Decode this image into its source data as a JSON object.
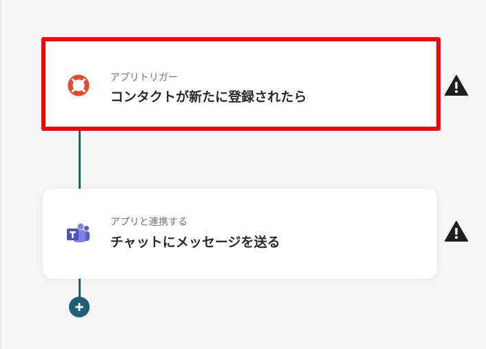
{
  "flow": {
    "steps": [
      {
        "type_label": "アプリトリガー",
        "title": "コンタクトが新たに登録されたら",
        "icon": "lifebuoy-icon",
        "highlighted": true
      },
      {
        "type_label": "アプリと連携する",
        "title": "チャットにメッセージを送る",
        "icon": "teams-icon",
        "highlighted": false
      }
    ],
    "warning_icon": "warning-icon",
    "add_icon": "plus-icon"
  },
  "colors": {
    "highlight_border": "#ff0000",
    "connector": "#1d5f73",
    "lifebuoy_red": "#e8492c",
    "teams_purple": "#5b5fc7",
    "warning": "#1f1f1f"
  }
}
